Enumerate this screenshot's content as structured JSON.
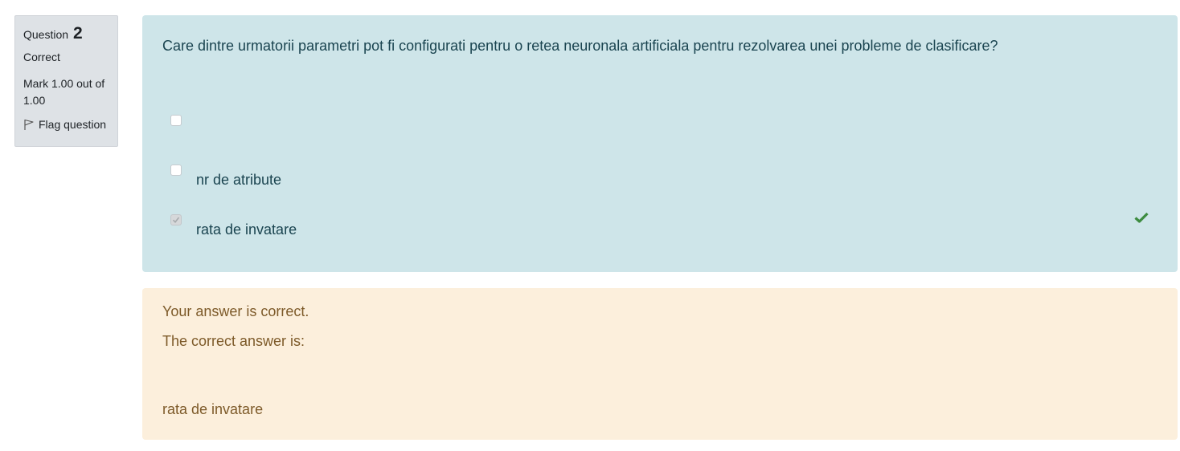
{
  "info": {
    "question_word": "Question",
    "question_number": "2",
    "state": "Correct",
    "grade_line1": "Mark 1.00 out of",
    "grade_line2": "1.00",
    "flag_label": "Flag question",
    "flag_icon": "flag-icon"
  },
  "question": {
    "text": "Care dintre urmatorii parametri pot fi configurati pentru o retea neuronala artificiala pentru rezolvarea unei probleme de clasificare?",
    "options": [
      {
        "label": "",
        "checked": false
      },
      {
        "label": "nr de atribute",
        "checked": false
      },
      {
        "label": "rata de invatare",
        "checked": true
      }
    ],
    "correct_icon": "check-icon",
    "correct_icon_color": "#3d8c40"
  },
  "feedback": {
    "result": "Your answer is correct.",
    "right_answer_label": "The correct answer is:",
    "right_answer": "rata de invatare"
  },
  "colors": {
    "info_bg": "#dee2e6",
    "question_bg": "#cee5e9",
    "feedback_bg": "#fcefdc"
  }
}
